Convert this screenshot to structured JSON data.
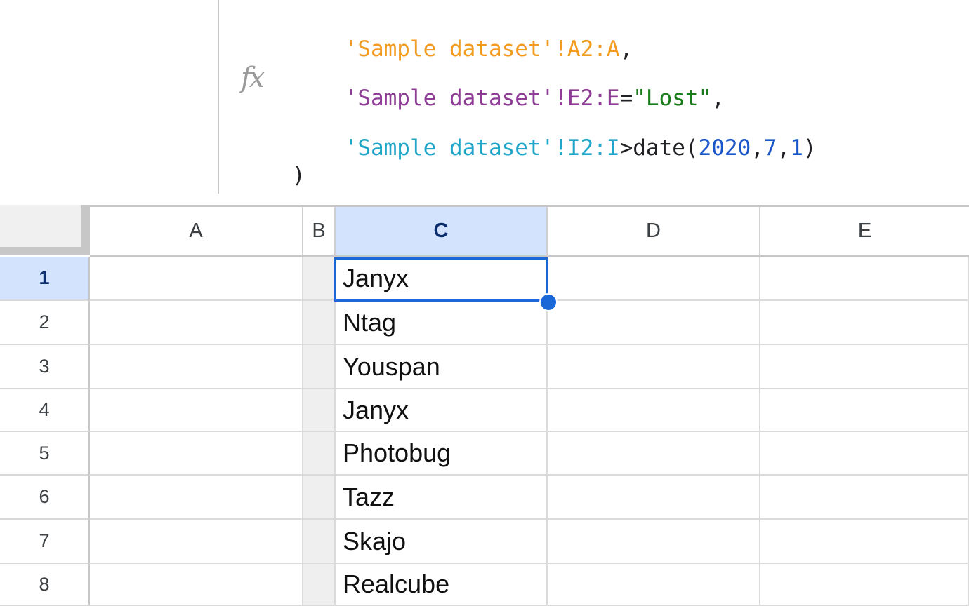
{
  "formula": {
    "fx_label": "fx",
    "line1": {
      "ref": "'Sample dataset'!A2:A",
      "suffix": ","
    },
    "line2": {
      "ref": "'Sample dataset'!E2:E",
      "op": "=",
      "string": "\"Lost\"",
      "suffix": ","
    },
    "line3": {
      "ref": "'Sample dataset'!I2:I",
      "op": ">date(",
      "n1": "2020",
      "c1": ",",
      "n2": "7",
      "c2": ",",
      "n3": "1",
      "close": ")"
    },
    "line4": ")"
  },
  "columns": [
    "A",
    "B",
    "C",
    "D",
    "E"
  ],
  "selected_column": "C",
  "rows": [
    {
      "num": "1",
      "c": "Janyx"
    },
    {
      "num": "2",
      "c": "Ntag"
    },
    {
      "num": "3",
      "c": "Youspan"
    },
    {
      "num": "4",
      "c": "Janyx"
    },
    {
      "num": "5",
      "c": "Photobug"
    },
    {
      "num": "6",
      "c": "Tazz"
    },
    {
      "num": "7",
      "c": "Skajo"
    },
    {
      "num": "8",
      "c": "Realcube"
    }
  ],
  "selected_row": "1",
  "active_cell": "C1",
  "colors": {
    "accent": "#1a67d8",
    "header_selected": "#d3e3fd",
    "ref1": "#f29b1e",
    "ref2": "#8e3c95",
    "ref3": "#1fa6c9",
    "string": "#1b7c1b",
    "number": "#1a56c9"
  }
}
